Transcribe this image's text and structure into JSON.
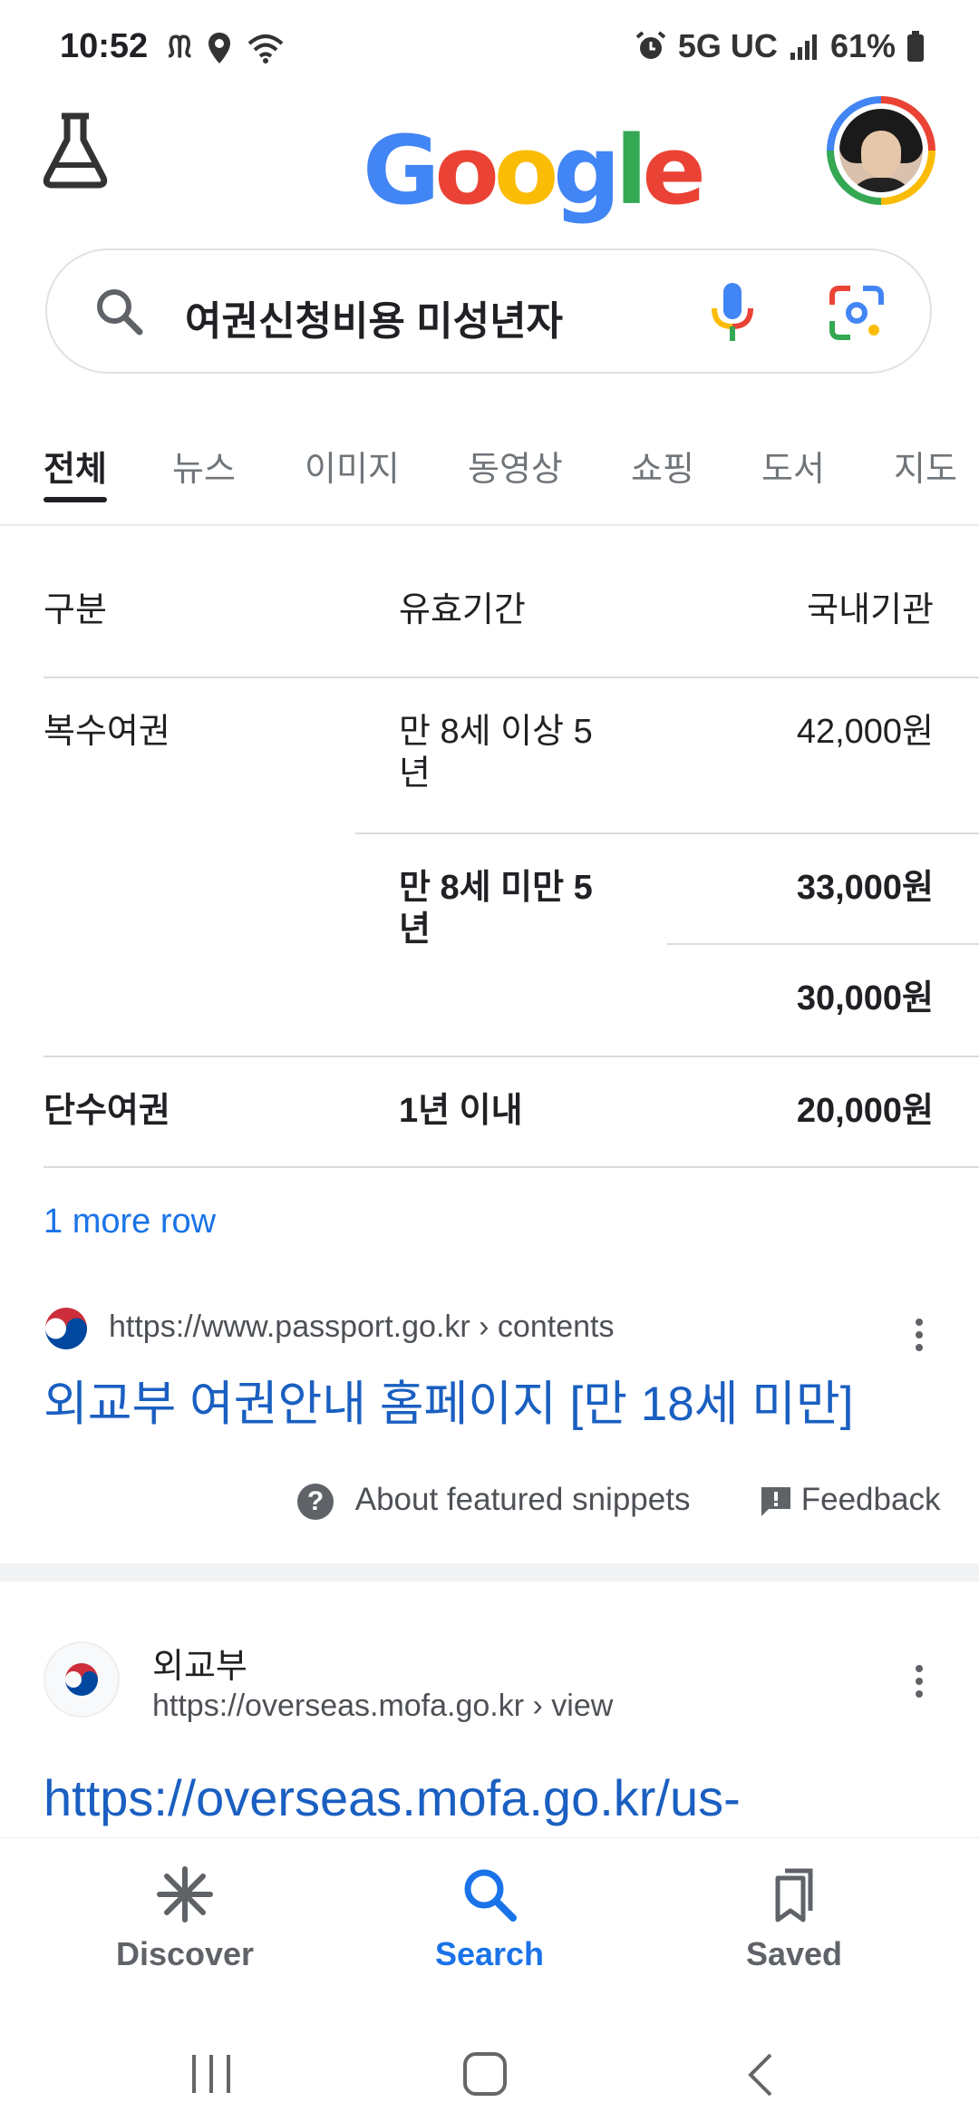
{
  "status_bar": {
    "time": "10:52",
    "network": "5G UC",
    "battery": "61%"
  },
  "header": {
    "logo": [
      "G",
      "o",
      "o",
      "g",
      "l",
      "e"
    ],
    "logo_colors": [
      "#4285f4",
      "#ea4335",
      "#fbbc05",
      "#4285f4",
      "#34a853",
      "#ea4335"
    ]
  },
  "search": {
    "query": "여권신청비용 미성년자"
  },
  "tabs": [
    "전체",
    "뉴스",
    "이미지",
    "동영상",
    "쇼핑",
    "도서",
    "지도"
  ],
  "table": {
    "headers": [
      "구분",
      "유효기간",
      "국내기관"
    ],
    "rows": [
      {
        "type": "복수여권",
        "period": "만 8세 이상 5년",
        "fee": "42,000원"
      },
      {
        "type": "",
        "period": "만 8세 미만 5년",
        "fee": "33,000원"
      },
      {
        "type": "",
        "period": "",
        "fee": "30,000원"
      },
      {
        "type": "단수여권",
        "period": "1년 이내",
        "fee": "20,000원"
      }
    ],
    "more_rows": "1 more row"
  },
  "featured_result": {
    "url": "https://www.passport.go.kr › contents",
    "title": "외교부 여권안내 홈페이지 [만 18세 미만]",
    "about": "About featured snippets",
    "feedback": "Feedback"
  },
  "result2": {
    "site_name": "외교부",
    "url": "https://overseas.mofa.go.kr › view",
    "title": "https://overseas.mofa.go.kr/us-"
  },
  "bottom_nav": {
    "discover": "Discover",
    "search": "Search",
    "saved": "Saved"
  },
  "colors": {
    "accent": "#1a73e8",
    "link": "#1a5fc1"
  }
}
